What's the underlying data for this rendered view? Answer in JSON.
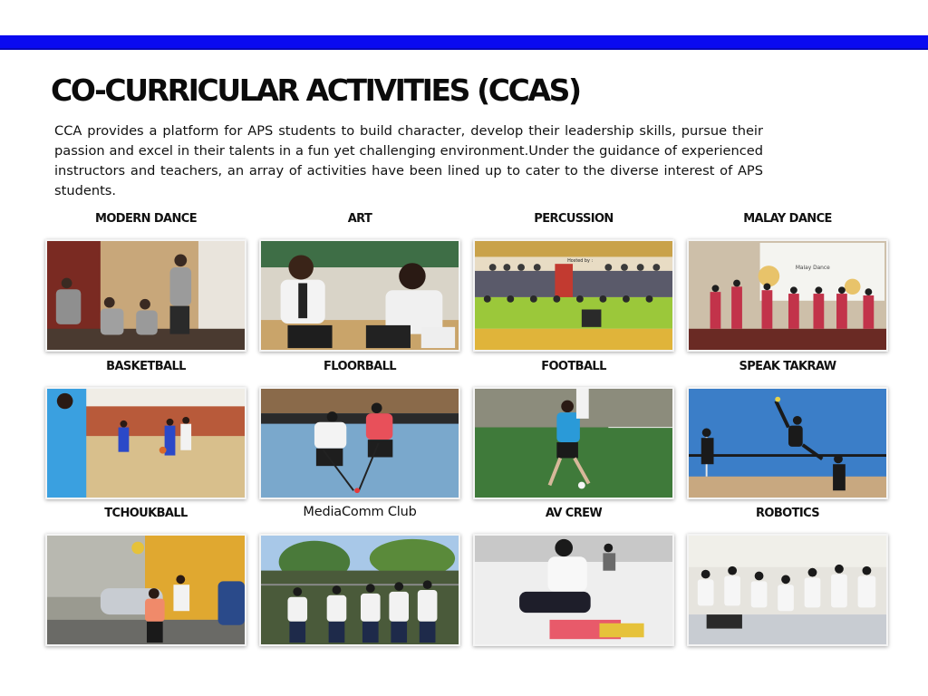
{
  "title": "CO-CURRICULAR ACTIVITIES (CCAS)",
  "intro": "CCA provides a platform for APS students to build character, develop their leadership skills, pursue their passion and excel in their talents in a fun yet challenging environment.Under the guidance of experienced instructors and teachers, an array of activities have been lined up to cater to the diverse interest of APS students.",
  "activities": [
    {
      "label": "MODERN DANCE"
    },
    {
      "label": "ART"
    },
    {
      "label": "PERCUSSION"
    },
    {
      "label": "MALAY DANCE"
    },
    {
      "label": "BASKETBALL"
    },
    {
      "label": "FLOORBALL"
    },
    {
      "label": "FOOTBALL"
    },
    {
      "label": "SPEAK TAKRAW"
    },
    {
      "label": "TCHOUKBALL"
    },
    {
      "label": "MediaComm Club"
    },
    {
      "label": "AV CREW"
    },
    {
      "label": "ROBOTICS"
    }
  ],
  "photo_texts": {
    "percussion_banner": "Hosted by :",
    "malay_dance_screen": "Malay Dance"
  },
  "colors": {
    "top_bar": "#0a0af0"
  }
}
